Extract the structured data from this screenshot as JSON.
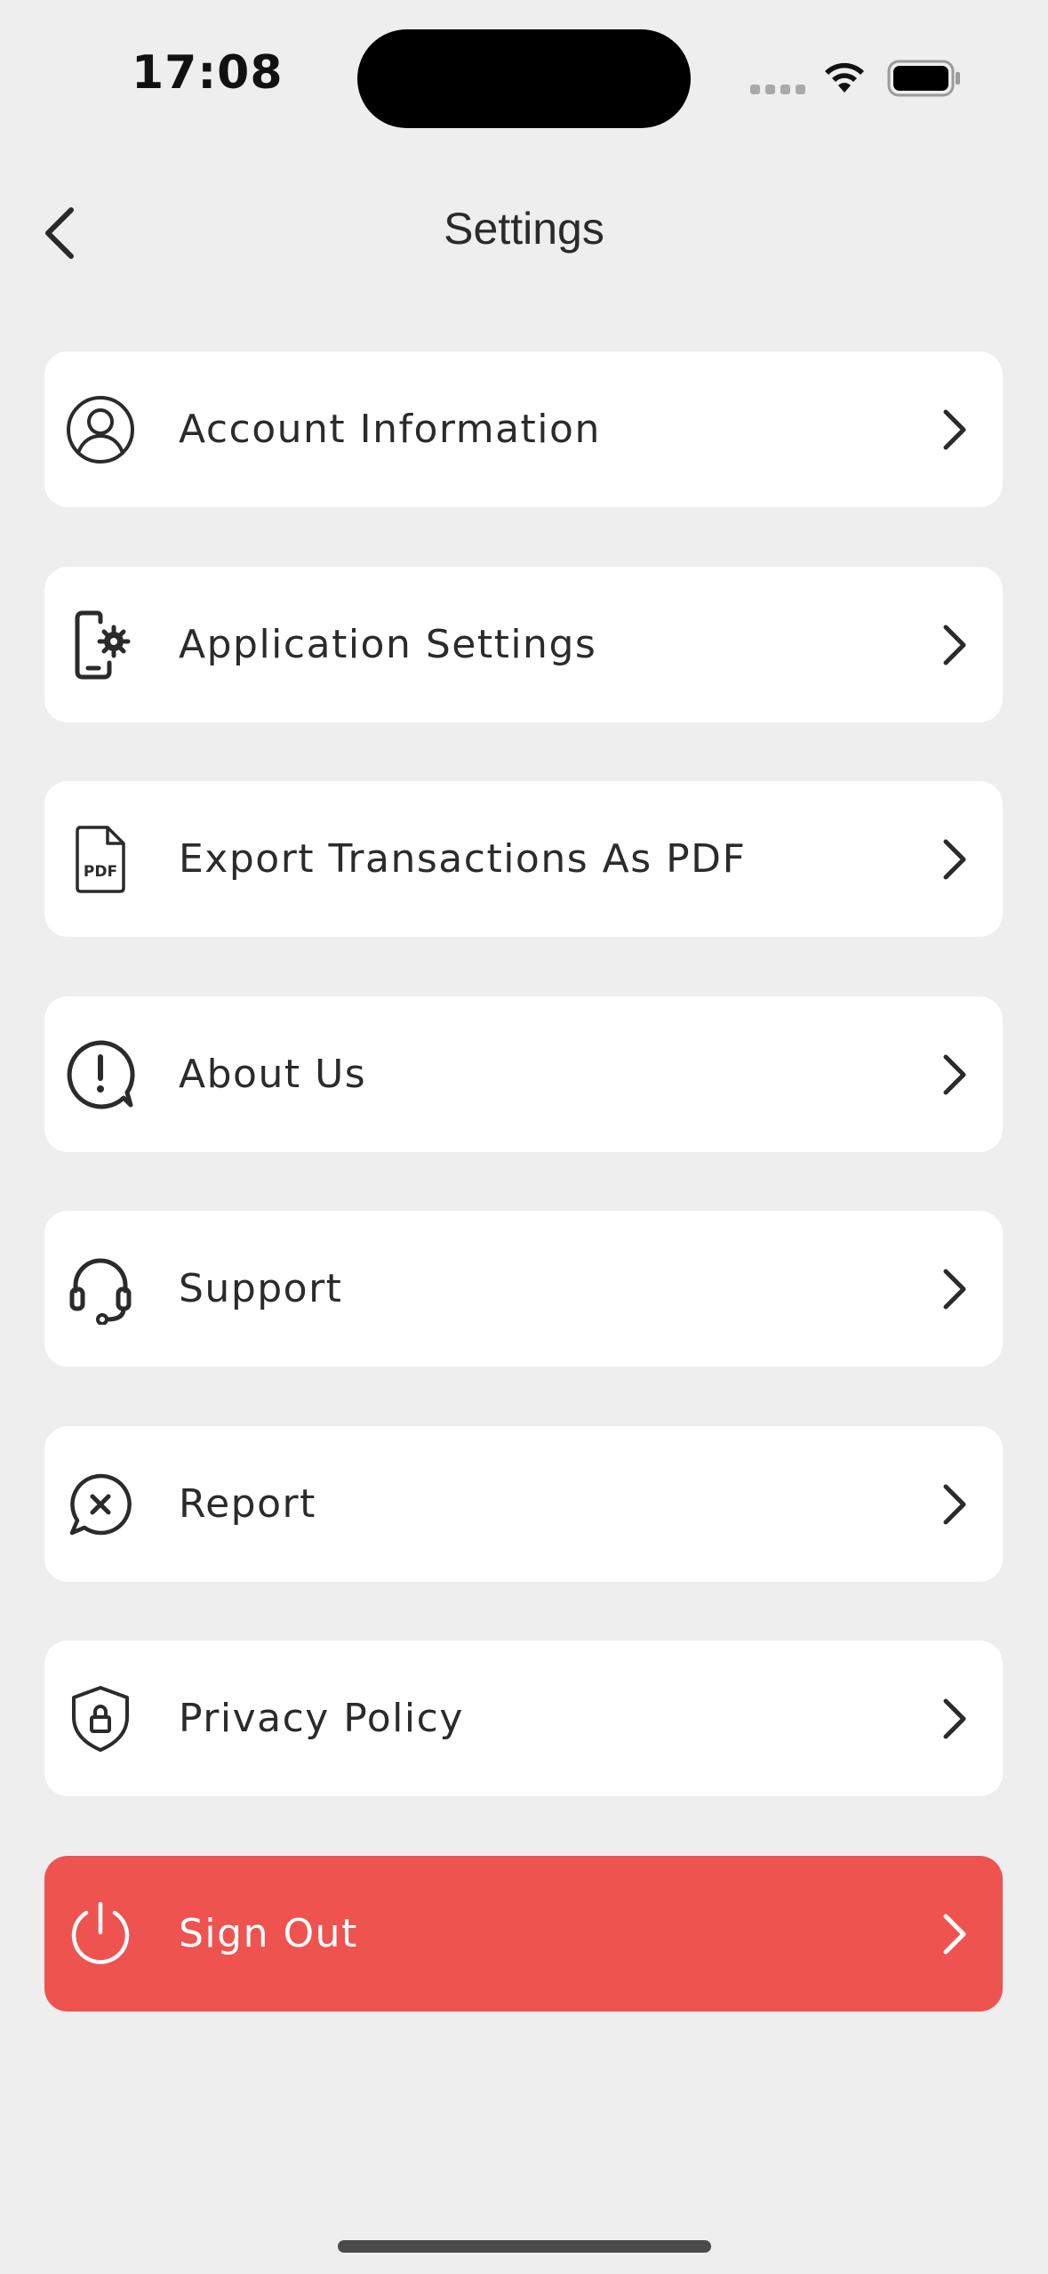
{
  "status_bar": {
    "time": "17:08",
    "wifi_icon": "wifi-icon",
    "battery_icon": "battery-icon",
    "signal_icon": "cellular-signal-icon"
  },
  "header": {
    "title": "Settings",
    "back_icon": "chevron-left-icon"
  },
  "menu": {
    "items": [
      {
        "label": "Account Information",
        "icon": "user-circle-icon"
      },
      {
        "label": "Application Settings",
        "icon": "phone-gear-icon"
      },
      {
        "label": "Export Transactions As PDF",
        "icon": "pdf-file-icon"
      },
      {
        "label": "About Us",
        "icon": "info-bubble-icon"
      },
      {
        "label": "Support",
        "icon": "headset-icon"
      },
      {
        "label": "Report",
        "icon": "report-bubble-icon"
      },
      {
        "label": "Privacy Policy",
        "icon": "shield-lock-icon"
      },
      {
        "label": "Sign Out",
        "icon": "power-icon"
      }
    ]
  },
  "colors": {
    "background": "#eeeeee",
    "card": "#ffffff",
    "sign_out": "#ef5350",
    "text": "#2b2b2b"
  }
}
